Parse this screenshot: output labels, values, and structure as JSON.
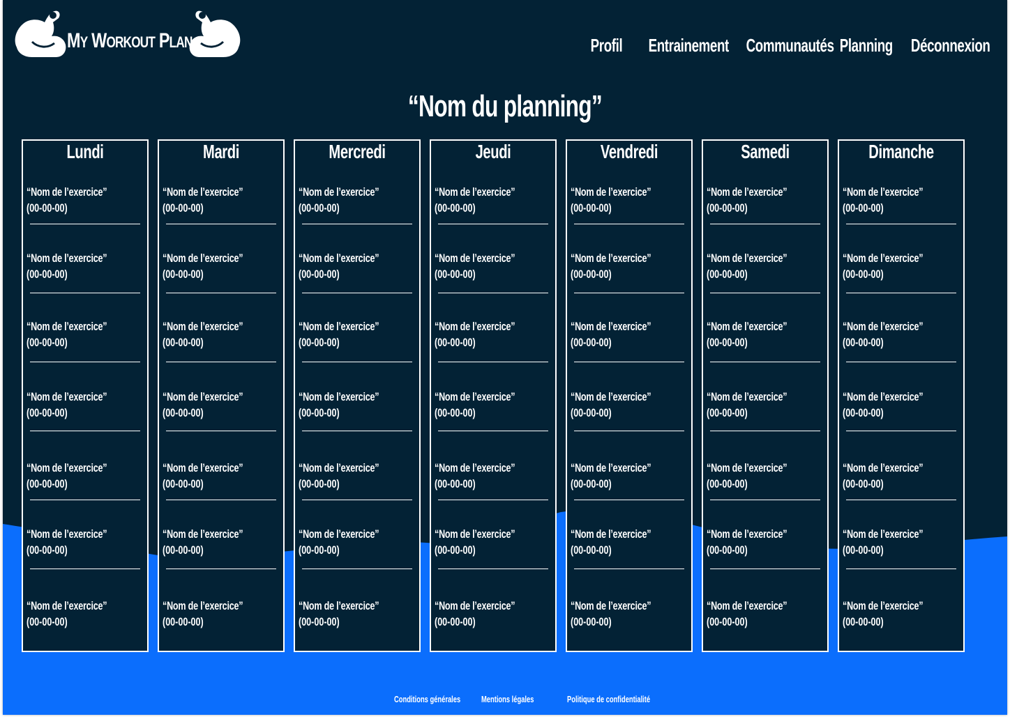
{
  "brand": {
    "name_parts": [
      "M",
      "Y",
      "W",
      "ORKOUT",
      "P",
      "LAN"
    ],
    "logo_icon": "flexed-biceps-icon"
  },
  "nav": {
    "profil": "Profil",
    "entrainement": "Entrainement",
    "communautes": "Communautés",
    "planning": "Planning",
    "deconnexion": "Déconnexion"
  },
  "planning_title": "“Nom du planning”",
  "exercise_name": "“Nom de l’exercice”",
  "exercise_time": "(00-00-00)",
  "days": [
    "Lundi",
    "Mardi",
    "Mercredi",
    "Jeudi",
    "Vendredi",
    "Samedi",
    "Dimanche"
  ],
  "exercises_per_day": 7,
  "footer": {
    "conditions": "Conditions générales",
    "mentions": "Mentions légales",
    "politique": "Politique de confidentialité"
  },
  "colors": {
    "background": "#032235",
    "accent_wave": "#0b6efd",
    "text": "#ffffff"
  }
}
